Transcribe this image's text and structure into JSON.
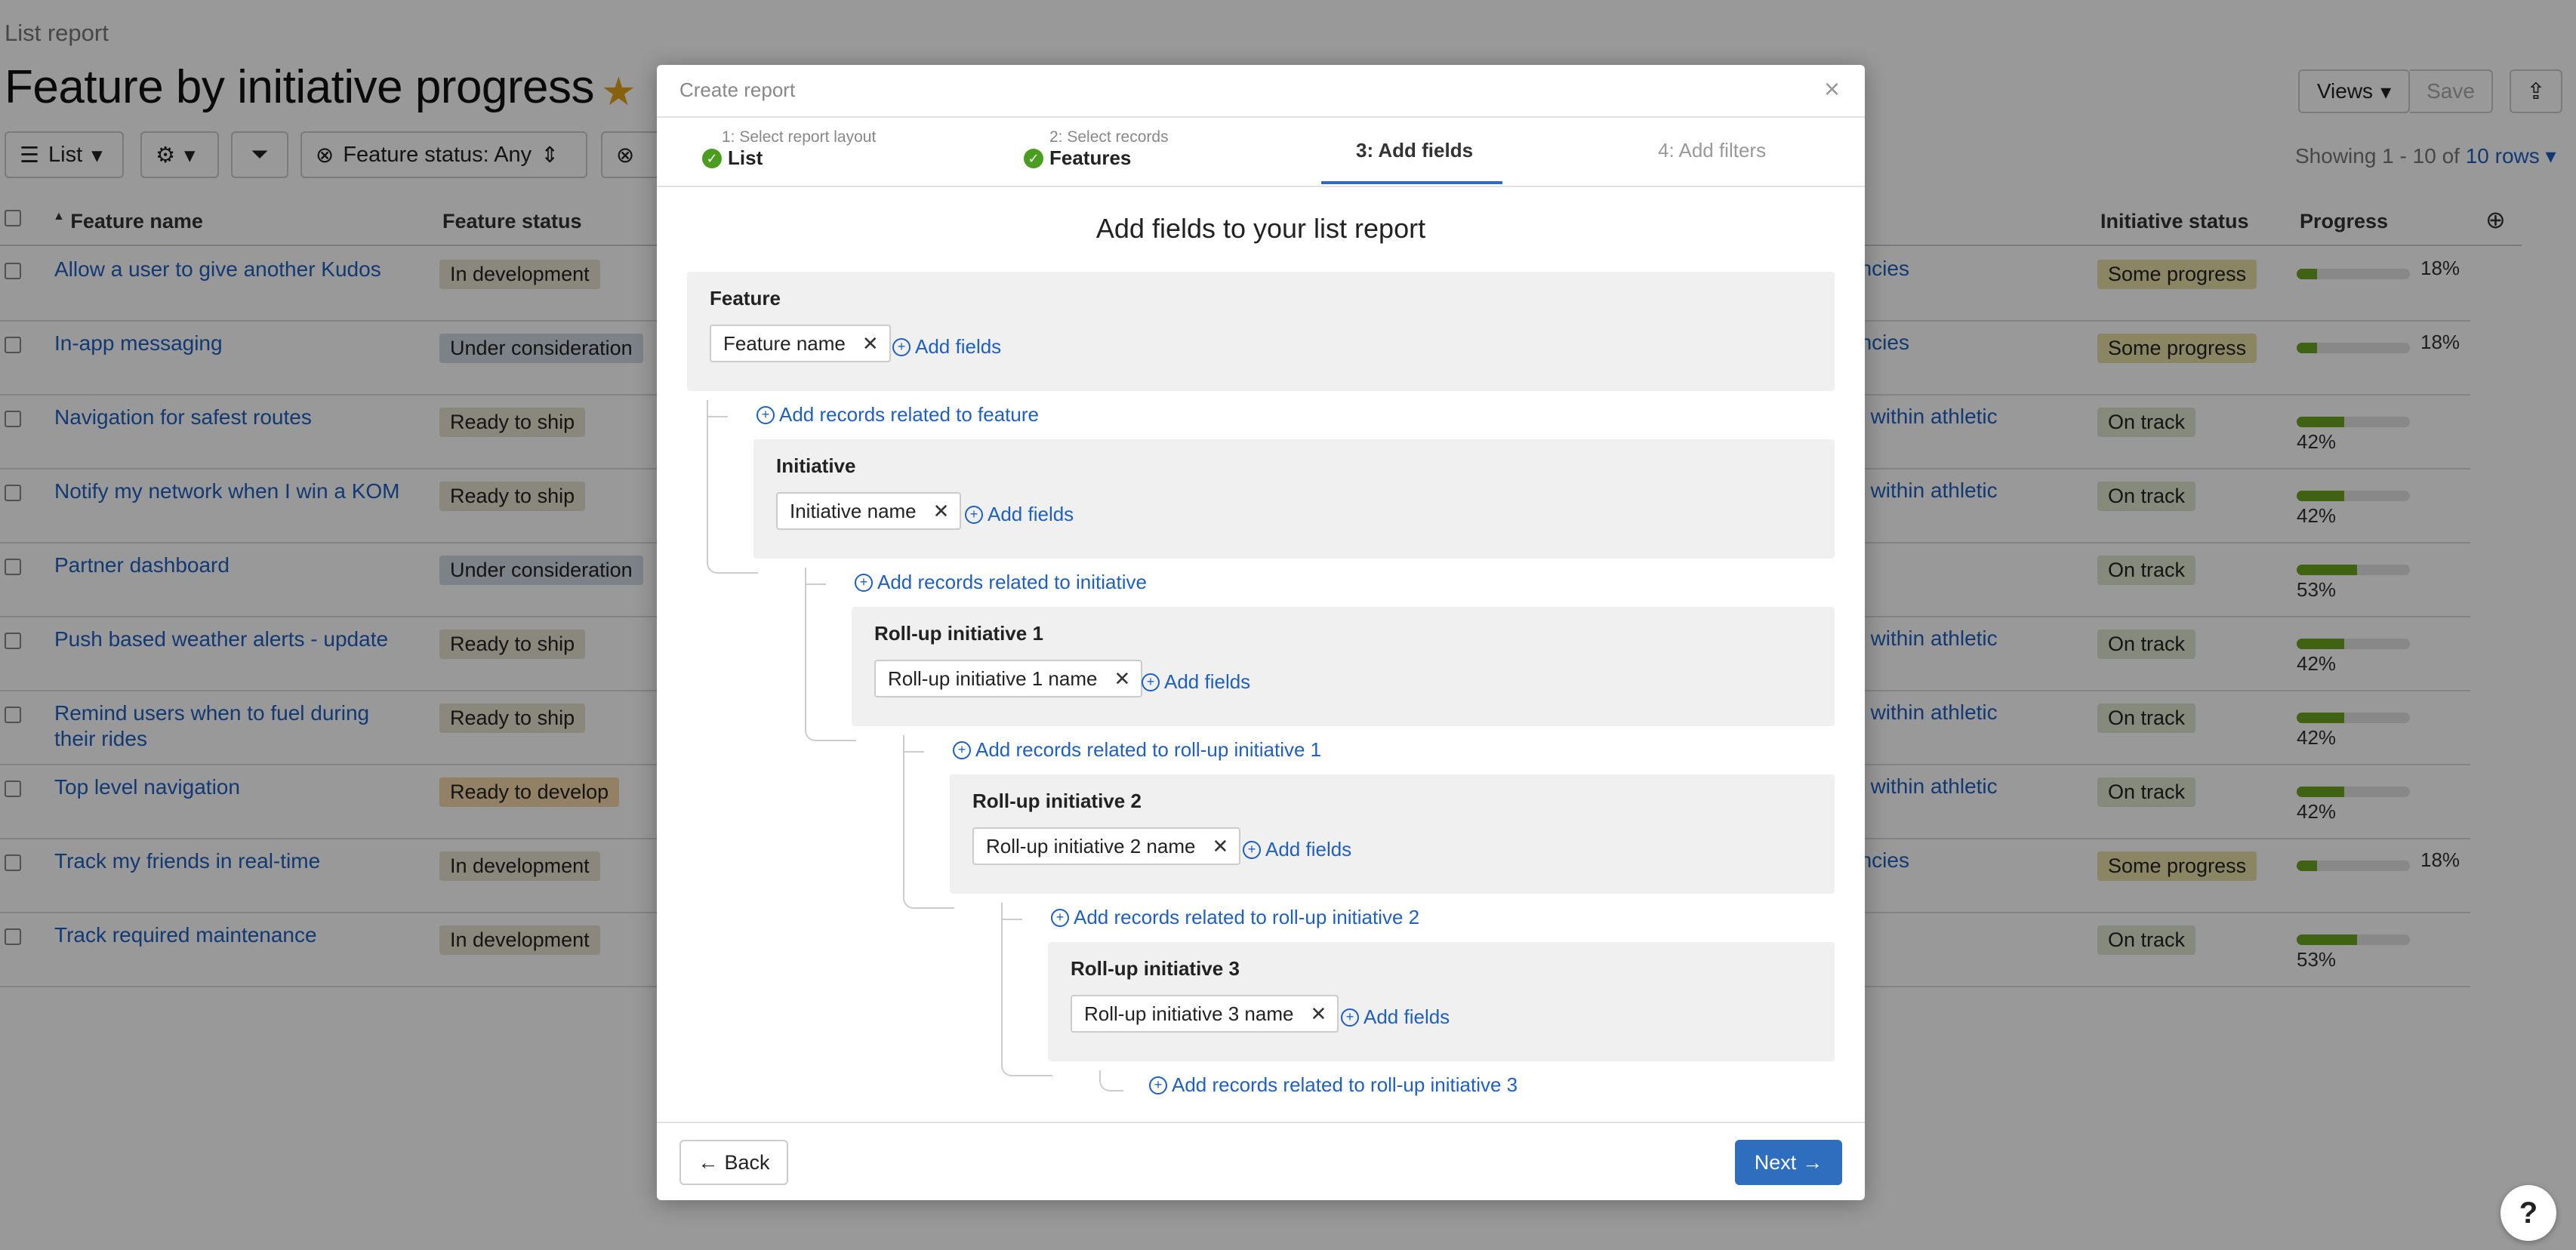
{
  "page": {
    "breadcrumb": "List report",
    "title": "Feature by initiative progress",
    "views_label": "Views",
    "save_label": "Save",
    "toolbar": {
      "list_label": "List",
      "feature_status_filter": "Feature status: Any"
    },
    "showing_prefix": "Showing 1 - 10 of",
    "showing_link": "10 rows",
    "columns": [
      "Feature name",
      "Feature status",
      "Initiative status",
      "Progress"
    ],
    "rows": [
      {
        "name": "Allow a user to give another Kudos",
        "status": "In development",
        "status_color": "#e6e2cf",
        "init_link": "encies",
        "init_status": "Some progress",
        "init_color": "#e6dfa6",
        "progress": 18
      },
      {
        "name": "In-app messaging",
        "status": "Under consideration",
        "status_color": "#cfd9e2",
        "init_link": "encies",
        "init_status": "Some progress",
        "init_color": "#e6dfa6",
        "progress": 18
      },
      {
        "name": "Navigation for safest routes",
        "status": "Ready to ship",
        "status_color": "#e6e2cf",
        "init_link": "ip within athletic",
        "init_status": "On track",
        "init_color": "#dfe6cf",
        "progress": 42
      },
      {
        "name": "Notify my network when I win a KOM",
        "status": "Ready to ship",
        "status_color": "#e6e2cf",
        "init_link": "ip within athletic",
        "init_status": "On track",
        "init_color": "#dfe6cf",
        "progress": 42
      },
      {
        "name": "Partner dashboard",
        "status": "Under consideration",
        "status_color": "#cfd9e2",
        "init_link": "",
        "init_status": "On track",
        "init_color": "#dfe6cf",
        "progress": 53
      },
      {
        "name": "Push based weather alerts - update",
        "status": "Ready to ship",
        "status_color": "#e6e2cf",
        "init_link": "ip within athletic",
        "init_status": "On track",
        "init_color": "#dfe6cf",
        "progress": 42
      },
      {
        "name": "Remind users when to fuel during their rides",
        "status": "Ready to ship",
        "status_color": "#e6e2cf",
        "init_link": "ip within athletic",
        "init_status": "On track",
        "init_color": "#dfe6cf",
        "progress": 42
      },
      {
        "name": "Top level navigation",
        "status": "Ready to develop",
        "status_color": "#f3d8a8",
        "init_link": "ip within athletic",
        "init_status": "On track",
        "init_color": "#dfe6cf",
        "progress": 42
      },
      {
        "name": "Track my friends in real-time",
        "status": "In development",
        "status_color": "#e6e2cf",
        "init_link": "encies",
        "init_status": "Some progress",
        "init_color": "#e6dfa6",
        "progress": 18
      },
      {
        "name": "Track required maintenance",
        "status": "In development",
        "status_color": "#e6e2cf",
        "init_link": "",
        "init_status": "On track",
        "init_color": "#dfe6cf",
        "progress": 53
      }
    ]
  },
  "modal": {
    "title": "Create report",
    "close_icon": "×",
    "steps": [
      {
        "caption": "1: Select report layout",
        "value": "List"
      },
      {
        "caption": "2: Select records",
        "value": "Features"
      },
      {
        "label": "3: Add fields"
      },
      {
        "label": "4: Add filters"
      }
    ],
    "heading": "Add fields to your list report",
    "add_fields_label": "Add fields",
    "sections": [
      {
        "title": "Feature",
        "chip": "Feature name",
        "add_related": "Add records related to feature"
      },
      {
        "title": "Initiative",
        "chip": "Initiative name",
        "add_related": "Add records related to initiative"
      },
      {
        "title": "Roll-up initiative 1",
        "chip": "Roll-up initiative 1 name",
        "add_related": "Add records related to roll-up initiative 1"
      },
      {
        "title": "Roll-up initiative 2",
        "chip": "Roll-up initiative 2 name",
        "add_related": "Add records related to roll-up initiative 2"
      },
      {
        "title": "Roll-up initiative 3",
        "chip": "Roll-up initiative 3 name",
        "add_related": "Add records related to roll-up initiative 3"
      }
    ],
    "back_label": "Back",
    "next_label": "Next"
  },
  "colors": {
    "link": "#1f5fbf",
    "primary": "#2f6dbf",
    "progress": "#6aa620",
    "check": "#4a9d1f"
  },
  "icons": {
    "star": "star-icon",
    "share": "share-icon",
    "list": "list-icon",
    "gear": "gear-icon",
    "filter": "filter-icon",
    "clear": "clear-filter-icon",
    "help": "help-icon"
  }
}
